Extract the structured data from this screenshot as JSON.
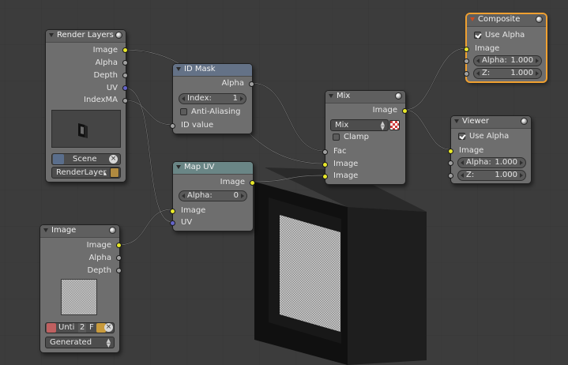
{
  "nodes": {
    "render_layers": {
      "title": "Render Layers",
      "outputs": [
        "Image",
        "Alpha",
        "Depth",
        "UV",
        "IndexMA"
      ],
      "scene": "Scene",
      "layer": "RenderLayer"
    },
    "id_mask": {
      "title": "ID Mask",
      "output": "Alpha",
      "index_label": "Index:",
      "index_value": "1",
      "anti_aliasing_label": "Anti-Aliasing",
      "anti_aliasing_checked": false,
      "input": "ID value"
    },
    "map_uv": {
      "title": "Map UV",
      "output": "Image",
      "alpha_label": "Alpha:",
      "alpha_value": "0",
      "inputs": [
        "Image",
        "UV"
      ]
    },
    "image": {
      "title": "Image",
      "outputs": [
        "Image",
        "Alpha",
        "Depth"
      ],
      "image_name": "Unti",
      "users": "2",
      "fake_label": "F",
      "source": "Generated"
    },
    "mix": {
      "title": "Mix",
      "output": "Image",
      "blend_mode": "Mix",
      "clamp_label": "Clamp",
      "clamp_checked": false,
      "inputs": [
        "Fac",
        "Image",
        "Image"
      ]
    },
    "composite": {
      "title": "Composite",
      "use_alpha_label": "Use Alpha",
      "use_alpha_checked": true,
      "input": "Image",
      "alpha_label": "Alpha:",
      "alpha_value": "1.000",
      "z_label": "Z:",
      "z_value": "1.000"
    },
    "viewer": {
      "title": "Viewer",
      "use_alpha_label": "Use Alpha",
      "use_alpha_checked": true,
      "input": "Image",
      "alpha_label": "Alpha:",
      "alpha_value": "1.000",
      "z_label": "Z:",
      "z_value": "1.000"
    }
  },
  "colors": {
    "editor_background": "#3c3c3c",
    "node_body": "#6e6e6e",
    "image_socket": "#e8e82a",
    "value_socket": "#a1a1a1",
    "vector_socket": "#6464c8",
    "active_outline": "#f0a030",
    "output_node_marker": "#d24a1e"
  },
  "icons": {
    "node_preview": "material-sphere-icon",
    "node_collapse": "triangle-down-icon",
    "scene_browse": "scene-icon",
    "clear": "x-circle-icon",
    "render_result": "render-result-icon",
    "image_browse": "image-icon",
    "open_file": "folder-icon",
    "blend_color": "checker-icon"
  }
}
